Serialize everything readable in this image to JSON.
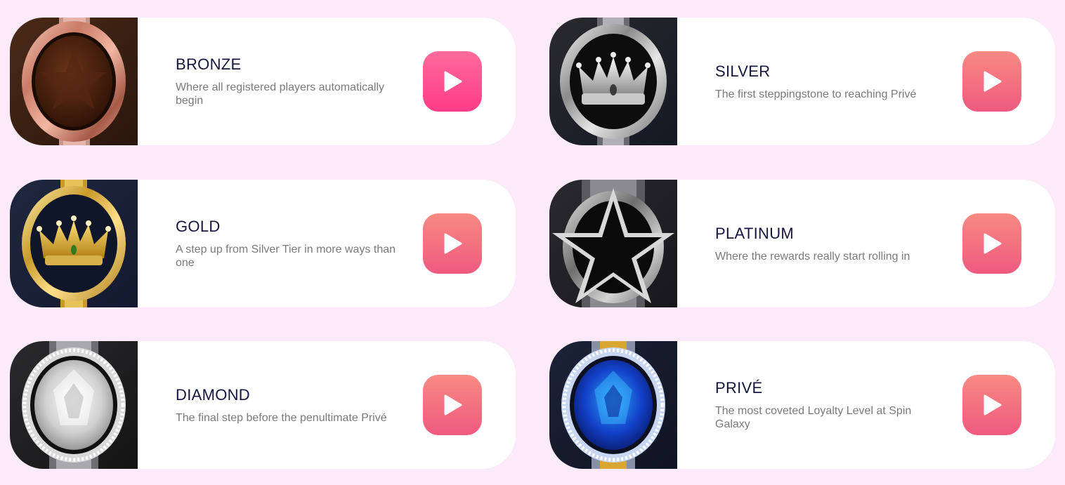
{
  "tiers": [
    {
      "title": "BRONZE",
      "description": "Where all registered players automatically begin",
      "badge": "bronze-star-badge-icon",
      "button_color": "#ff4a8f"
    },
    {
      "title": "SILVER",
      "description": "The first steppingstone to reaching Privé",
      "badge": "silver-crown-badge-icon",
      "button_color": "#f4707f"
    },
    {
      "title": "GOLD",
      "description": "A step up from Silver Tier in more ways than one",
      "badge": "gold-crown-badge-icon",
      "button_color": "#f4707f"
    },
    {
      "title": "PLATINUM",
      "description": "Where the rewards really start rolling in",
      "badge": "platinum-star-badge-icon",
      "button_color": "#f4707f"
    },
    {
      "title": "DIAMOND",
      "description": "The final step before the penultimate Privé",
      "badge": "diamond-badge-icon",
      "button_color": "#f4707f"
    },
    {
      "title": "PRIVÉ",
      "description": "The most coveted Loyalty Level at Spin Galaxy",
      "badge": "sapphire-gem-badge-icon",
      "button_color": "#f4707f"
    }
  ],
  "play_icon": "play-icon"
}
